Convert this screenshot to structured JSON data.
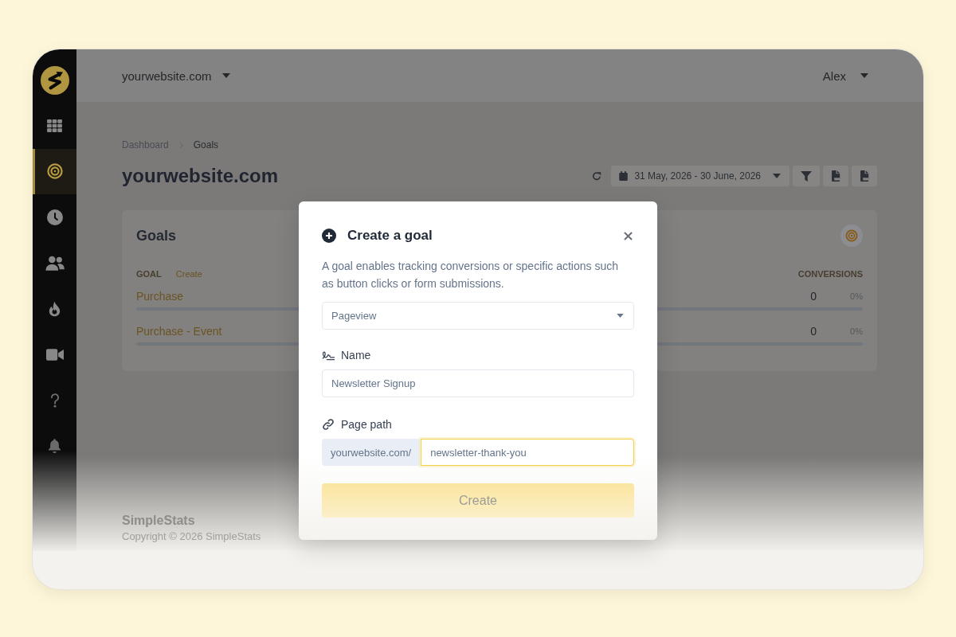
{
  "header": {
    "site_selector": "yourwebsite.com",
    "user_menu": "Alex"
  },
  "sidebar": {
    "items": [
      {
        "selected": false
      },
      {
        "selected": true
      },
      {
        "selected": false
      },
      {
        "selected": false
      },
      {
        "selected": false
      },
      {
        "selected": false
      },
      {
        "selected": false
      },
      {
        "selected": false
      }
    ]
  },
  "breadcrumb": [
    "Dashboard",
    "Goals"
  ],
  "page_title": "yourwebsite.com",
  "toolbar": {
    "date_range": "31 May, 2026 - 30 June, 2026"
  },
  "goals_card": {
    "title": "Goals",
    "columns": {
      "goal": "GOAL",
      "create_link": "Create",
      "conversions": "CONVERSIONS"
    },
    "rows": [
      {
        "name": "Purchase",
        "conversions": "0",
        "percent": "0%",
        "level": 0
      },
      {
        "name": "Purchase - Event",
        "conversions": "0",
        "percent": "0%",
        "level": 0
      }
    ]
  },
  "footer": {
    "brand": "SimpleStats",
    "copyright": "Copyright © 2026 SimpleStats"
  },
  "modal": {
    "title": "Create a goal",
    "description": "A goal enables tracking conversions or specific actions such as button clicks or form submissions.",
    "goal_type": {
      "value": "Pageview"
    },
    "name_field": {
      "label": "Name",
      "value": "Newsletter Signup"
    },
    "path_field": {
      "label": "Page path",
      "prefix": "yourwebsite.com/",
      "value": "newsletter-thank-you",
      "focused": true
    },
    "submit_button": "Create"
  }
}
